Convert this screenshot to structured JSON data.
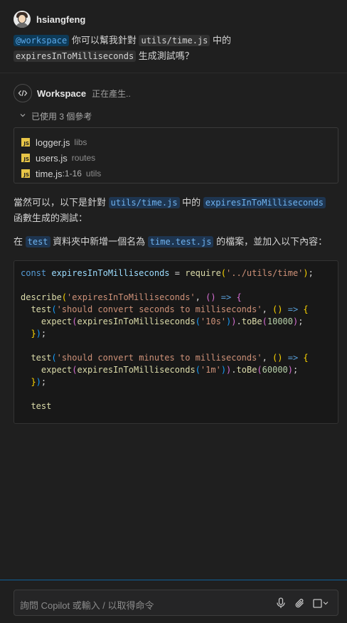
{
  "user": {
    "name": "hsiangfeng",
    "agent_chip": "@workspace",
    "seg1": " 你可以幫我針對 ",
    "file_chip": "utils/time.js",
    "seg2": " 中的",
    "func_chip": "expiresInToMilliseconds",
    "seg3": " 生成測試嗎？"
  },
  "agent": {
    "name": "Workspace",
    "status": "正在產生..",
    "icon": "code-brackets-icon"
  },
  "references": {
    "toggle_label": "已使用 3 個參考",
    "items": [
      {
        "name": "logger.js",
        "range": "",
        "dir": "libs"
      },
      {
        "name": "users.js",
        "range": "",
        "dir": "routes"
      },
      {
        "name": "time.js",
        "range": ":1-16",
        "dir": "utils"
      }
    ]
  },
  "answer": {
    "p1_a": "當然可以，以下是針對 ",
    "p1_chip1": "utils/time.js",
    "p1_b": " 中的 ",
    "p1_chip2": "expiresInToMilliseconds",
    "p1_c": " 函數生成的測試：",
    "p2_a": "在 ",
    "p2_chip1": "test",
    "p2_b": " 資料夾中新增一個名為 ",
    "p2_chip2": "time.test.js",
    "p2_c": " 的檔案，並加入以下內容："
  },
  "code": {
    "l1": {
      "kw": "const",
      "var": "expiresInToMilliseconds",
      "eq": " = ",
      "fn": "require",
      "str": "'../utils/time'",
      "end": ";"
    },
    "describe": "describe",
    "describe_str": "'expiresInToMilliseconds'",
    "test": "test",
    "test1_str": "'should convert seconds to milliseconds'",
    "test2_str": "'should convert minutes to milliseconds'",
    "expect": "expect",
    "func": "expiresInToMilliseconds",
    "arg1": "'10s'",
    "arg2": "'1m'",
    "toBe": "toBe",
    "num1": "10000",
    "num2": "60000",
    "arrow": "=>",
    "partial": "test"
  },
  "input": {
    "placeholder": "詢問 Copilot 或輸入 / 以取得命令",
    "icons": [
      "microphone-icon",
      "paperclip-icon",
      "square-icon",
      "chevron-down-icon"
    ]
  },
  "colors": {
    "accent": "#0e639c",
    "chip_blue_bg": "#1e3550",
    "js_badge": "#e8c547"
  }
}
